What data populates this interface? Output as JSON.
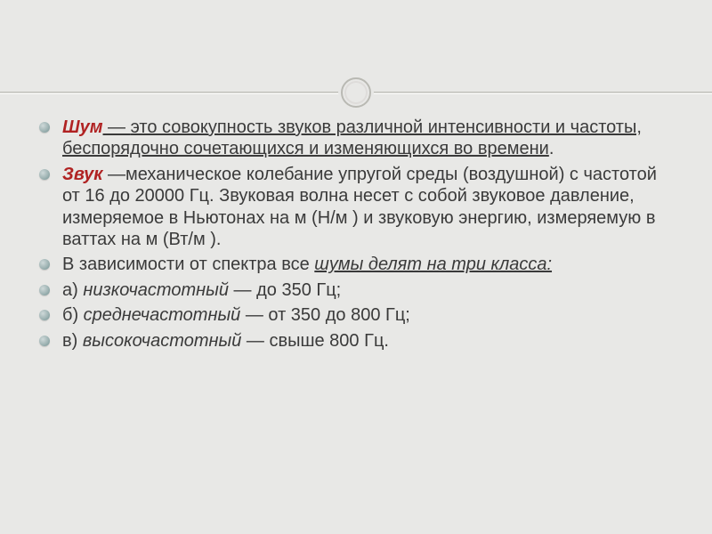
{
  "terms": {
    "shoom": "Шум",
    "zvuk": "Звук"
  },
  "defs": {
    "shoom_dash": " — ",
    "shoom_body": "это совокупность звуков различной интенсивности и частоты, беспорядочно сочетающихся и изменяющихся во времени",
    "shoom_period": ".",
    "zvuk_body": " —механическое колебание упругой среды (воздушной) с частотой от 16 до 20000 Гц. Звуковая волна несет с собой звуковое давление, измеряемое в Ньютонах на м (Н/м ) и звуковую энергию, измеряемую в ваттах на м (Вт/м )."
  },
  "spectrum": {
    "lead": "В зависимости от спектра все ",
    "phrase": "шумы делят на три класса:"
  },
  "classes": {
    "a_prefix": "а) ",
    "a_term": "низкочастотный",
    "a_tail": " — до 350 Гц;",
    "b_prefix": "б) ",
    "b_term": "среднечастотный",
    "b_tail": " — от 350 до 800 Гц;",
    "c_prefix": "в) ",
    "c_term": "высокочастотный",
    "c_tail": " — свыше 800 Гц."
  }
}
